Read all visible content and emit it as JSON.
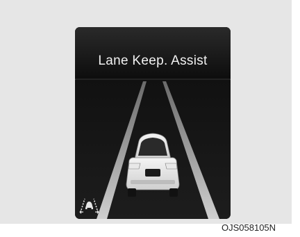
{
  "display": {
    "title": "Lane Keep. Assist",
    "indicator_icon": "lane-keep-assist-icon"
  },
  "figure_code": "OJS058105N",
  "colors": {
    "background": "#e6e6e6",
    "screen": "#0a0a0a",
    "lane_line": "#bdbdbd",
    "text": "#f2f2f2"
  }
}
